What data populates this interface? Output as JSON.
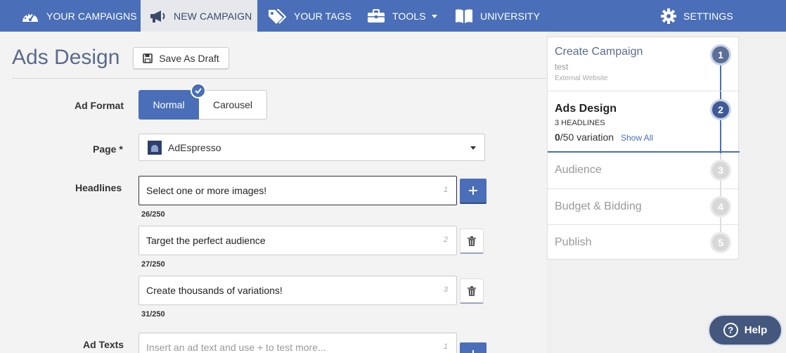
{
  "nav": {
    "items": [
      {
        "label": "YOUR CAMPAIGNS",
        "icon": "dashboard-icon"
      },
      {
        "label": "NEW CAMPAIGN",
        "icon": "megaphone-icon",
        "active": true
      },
      {
        "label": "YOUR TAGS",
        "icon": "tag-icon"
      },
      {
        "label": "TOOLS",
        "icon": "briefcase-icon"
      },
      {
        "label": "UNIVERSITY",
        "icon": "book-icon"
      },
      {
        "label": "SETTINGS",
        "icon": "gear-icon"
      }
    ]
  },
  "main": {
    "title": "Ads Design",
    "save_draft_label": "Save As Draft",
    "ad_format": {
      "label": "Ad Format",
      "options": [
        "Normal",
        "Carousel"
      ],
      "selected": "Normal"
    },
    "page": {
      "label": "Page *",
      "value": "AdEspresso"
    },
    "headlines": {
      "label": "Headlines",
      "items": [
        {
          "text": "Select one or more images!",
          "index": "1",
          "count": "26/250"
        },
        {
          "text": "Target the perfect audience",
          "index": "2",
          "count": "27/250"
        },
        {
          "text": "Create thousands of variations!",
          "index": "3",
          "count": "31/250"
        }
      ]
    },
    "ad_texts": {
      "label": "Ad Texts",
      "placeholder": "Insert an ad text and use + to test more...",
      "index": "1"
    }
  },
  "steps": [
    {
      "num": "1",
      "title": "Create Campaign",
      "sub": "test",
      "sub2": "External Website",
      "state": "done"
    },
    {
      "num": "2",
      "title": "Ads Design",
      "sub": "3 HEADLINES",
      "variation_count": "0",
      "variation_rest": "/50 variation",
      "show_all": "Show All",
      "state": "current"
    },
    {
      "num": "3",
      "title": "Audience",
      "state": "todo"
    },
    {
      "num": "4",
      "title": "Budget & Bidding",
      "state": "todo"
    },
    {
      "num": "5",
      "title": "Publish",
      "state": "todo"
    }
  ],
  "help": {
    "label": "Help",
    "icon_text": "?"
  },
  "colors": {
    "brand": "#4a6fb8",
    "nav_active_bg": "#e6e8ec",
    "help_bg": "#44587e"
  }
}
